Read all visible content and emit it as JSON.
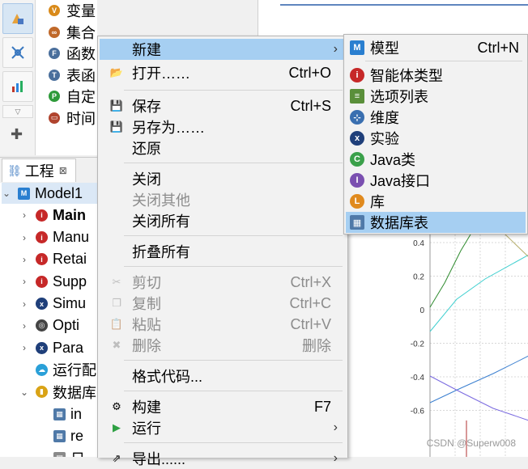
{
  "palette": {
    "items": [
      {
        "label": "变量",
        "icon": "variable-icon",
        "color": "#d98a1a",
        "glyph": "V"
      },
      {
        "label": "集合",
        "icon": "collection-icon",
        "color": "#c0692a",
        "glyph": "∞"
      },
      {
        "label": "函数",
        "icon": "function-icon",
        "color": "#4a6f9c",
        "glyph": "F"
      },
      {
        "label": "表函",
        "icon": "table-function-icon",
        "color": "#4a6f9c",
        "glyph": "T"
      },
      {
        "label": "自定",
        "icon": "custom-distribution-icon",
        "color": "#2e9a3a",
        "glyph": "P"
      },
      {
        "label": "时间",
        "icon": "schedule-icon",
        "color": "#b0442e",
        "glyph": "▭"
      }
    ]
  },
  "project": {
    "tab_label": "工程",
    "tab_close": "⊠",
    "tree": [
      {
        "label": "Model1",
        "icon": "model-icon",
        "color": "#2a7fd0",
        "glyph": "M",
        "twisty": "⌄",
        "indent": 14,
        "bold": false,
        "selected": true
      },
      {
        "label": "Main",
        "icon": "agent-main-icon",
        "color": "#c62828",
        "glyph": "i",
        "twisty": "›",
        "indent": 36,
        "bold": true
      },
      {
        "label": "Manu",
        "icon": "agent-icon",
        "color": "#c62828",
        "glyph": "i",
        "twisty": "›",
        "indent": 36,
        "bold": false
      },
      {
        "label": "Retai",
        "icon": "agent-icon",
        "color": "#c62828",
        "glyph": "i",
        "twisty": "›",
        "indent": 36,
        "bold": false
      },
      {
        "label": "Supp",
        "icon": "agent-icon",
        "color": "#c62828",
        "glyph": "i",
        "twisty": "›",
        "indent": 36,
        "bold": false
      },
      {
        "label": "Simu",
        "icon": "experiment-icon",
        "color": "#1f3f7a",
        "glyph": "x",
        "twisty": "›",
        "indent": 36,
        "bold": false
      },
      {
        "label": "Opti",
        "icon": "optimization-icon",
        "color": "#444444",
        "glyph": "◎",
        "twisty": "›",
        "indent": 36,
        "bold": false
      },
      {
        "label": "Para",
        "icon": "parameter-variation-icon",
        "color": "#1f3f7a",
        "glyph": "x",
        "twisty": "›",
        "indent": 36,
        "bold": false
      },
      {
        "label": "运行配",
        "icon": "run-config-icon",
        "color": "#2aa0d8",
        "glyph": "☁",
        "twisty": "",
        "indent": 36,
        "bold": false
      },
      {
        "label": "数据库",
        "icon": "database-icon",
        "color": "#d9a316",
        "glyph": "▮",
        "twisty": "⌄",
        "indent": 36,
        "bold": false
      },
      {
        "label": "in",
        "icon": "db-table-icon",
        "color": "#4f79a8",
        "glyph": "▦",
        "twisty": "",
        "indent": 58,
        "bold": false
      },
      {
        "label": "re",
        "icon": "db-table-icon",
        "color": "#4f79a8",
        "glyph": "▦",
        "twisty": "",
        "indent": 58,
        "bold": false
      },
      {
        "label": "日",
        "icon": "log-icon",
        "color": "#8a8a8a",
        "glyph": "▤",
        "twisty": "›",
        "indent": 58,
        "bold": false
      }
    ]
  },
  "context_menu": {
    "items": [
      {
        "label": "新建",
        "shortcut": "",
        "submenu": true,
        "icon": "",
        "disabled": false,
        "highlight": true
      },
      {
        "label": "打开……",
        "shortcut": "Ctrl+O",
        "submenu": false,
        "icon": "open-folder-icon",
        "disabled": false
      },
      {
        "sep": true
      },
      {
        "label": "保存",
        "shortcut": "Ctrl+S",
        "submenu": false,
        "icon": "save-icon",
        "disabled": false
      },
      {
        "label": "另存为……",
        "shortcut": "",
        "submenu": false,
        "icon": "save-as-icon",
        "disabled": false
      },
      {
        "label": "还原",
        "shortcut": "",
        "submenu": false,
        "icon": "",
        "disabled": false
      },
      {
        "sep": true
      },
      {
        "label": "关闭",
        "shortcut": "",
        "submenu": false,
        "icon": "",
        "disabled": false
      },
      {
        "label": "关闭其他",
        "shortcut": "",
        "submenu": false,
        "icon": "",
        "disabled": true
      },
      {
        "label": "关闭所有",
        "shortcut": "",
        "submenu": false,
        "icon": "",
        "disabled": false
      },
      {
        "sep": true
      },
      {
        "label": "折叠所有",
        "shortcut": "",
        "submenu": false,
        "icon": "",
        "disabled": false
      },
      {
        "sep": true
      },
      {
        "label": "剪切",
        "shortcut": "Ctrl+X",
        "submenu": false,
        "icon": "cut-icon",
        "disabled": true
      },
      {
        "label": "复制",
        "shortcut": "Ctrl+C",
        "submenu": false,
        "icon": "copy-icon",
        "disabled": true
      },
      {
        "label": "粘贴",
        "shortcut": "Ctrl+V",
        "submenu": false,
        "icon": "paste-icon",
        "disabled": true
      },
      {
        "label": "删除",
        "shortcut": "删除",
        "submenu": false,
        "icon": "delete-icon",
        "disabled": true
      },
      {
        "sep": true
      },
      {
        "label": "格式代码...",
        "shortcut": "",
        "submenu": false,
        "icon": "",
        "disabled": false
      },
      {
        "sep": true
      },
      {
        "label": "构建",
        "shortcut": "F7",
        "submenu": false,
        "icon": "build-icon",
        "disabled": false
      },
      {
        "label": "运行",
        "shortcut": "",
        "submenu": true,
        "icon": "run-icon",
        "disabled": false
      },
      {
        "sep": true
      },
      {
        "label": "导出......",
        "shortcut": "",
        "submenu": true,
        "icon": "export-icon",
        "disabled": false
      }
    ]
  },
  "submenu": {
    "items": [
      {
        "label": "模型",
        "shortcut": "Ctrl+N",
        "icon": "model-icon",
        "color": "#2a7fd0",
        "glyph": "M",
        "highlight": false
      },
      {
        "sep": true
      },
      {
        "label": "智能体类型",
        "shortcut": "",
        "icon": "agent-type-icon",
        "color": "#c62828",
        "glyph": "i",
        "highlight": false
      },
      {
        "label": "选项列表",
        "shortcut": "",
        "icon": "option-list-icon",
        "color": "#5a8f3a",
        "glyph": "≡",
        "highlight": false
      },
      {
        "label": "维度",
        "shortcut": "",
        "icon": "dimension-icon",
        "color": "#3a6fb0",
        "glyph": "⊹",
        "highlight": false
      },
      {
        "label": "实验",
        "shortcut": "",
        "icon": "experiment-icon",
        "color": "#1f3f7a",
        "glyph": "x",
        "highlight": false
      },
      {
        "label": "Java类",
        "shortcut": "",
        "icon": "java-class-icon",
        "color": "#3aa04a",
        "glyph": "C",
        "highlight": false
      },
      {
        "label": "Java接口",
        "shortcut": "",
        "icon": "java-interface-icon",
        "color": "#7a4fb0",
        "glyph": "I",
        "highlight": false
      },
      {
        "label": "库",
        "shortcut": "",
        "icon": "library-icon",
        "color": "#e08a1e",
        "glyph": "L",
        "highlight": false
      },
      {
        "label": "数据库表",
        "shortcut": "",
        "icon": "db-table-icon",
        "color": "#4f79a8",
        "glyph": "▦",
        "highlight": true
      }
    ]
  },
  "chart": {
    "y_ticks": [
      "0.4",
      "0.2",
      "0",
      "-0.2",
      "-0.4",
      "-0.6"
    ],
    "watermark": "CSDN @Superw008"
  }
}
